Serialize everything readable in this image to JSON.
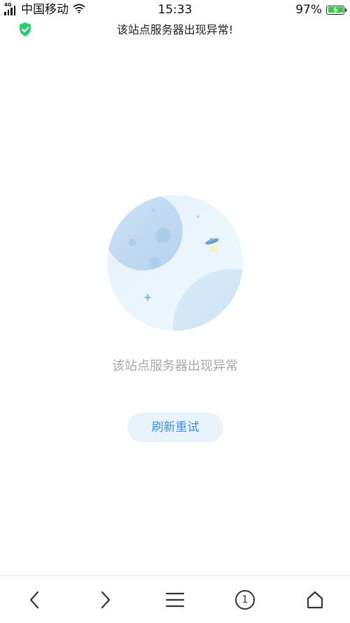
{
  "status_bar": {
    "network_tag": "4G",
    "carrier": "中国移动",
    "time": "15:33",
    "battery_percent": "97%",
    "battery_level": 0.97,
    "battery_color": "#2ecc40",
    "icons": [
      "signal-icon",
      "wifi-icon",
      "battery-icon",
      "charging-icon"
    ]
  },
  "title_bar": {
    "title": "该站点服务器出现异常!",
    "shield_icon": "shield-check-icon",
    "shield_color": "#2ecc71"
  },
  "error": {
    "message": "该站点服务器出现异常",
    "retry_label": "刷新重试",
    "illustration": "moon-planet-ufo-illustration",
    "accent_color": "#3a94d6"
  },
  "toolbar": {
    "items": [
      {
        "icon": "back-arrow-icon"
      },
      {
        "icon": "forward-arrow-icon"
      },
      {
        "icon": "menu-icon"
      },
      {
        "icon": "tabs-icon",
        "count": "1"
      },
      {
        "icon": "home-icon"
      }
    ]
  }
}
